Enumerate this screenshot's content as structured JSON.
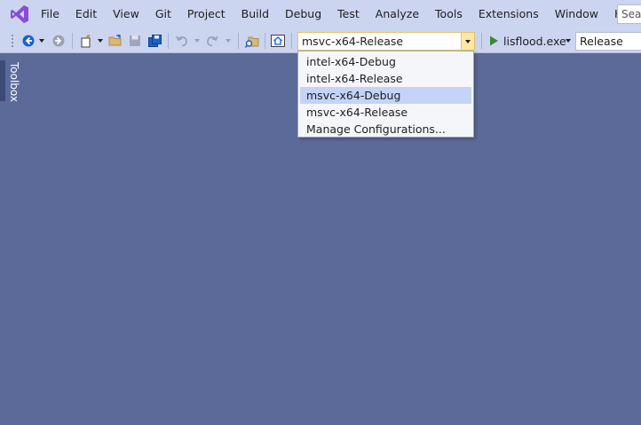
{
  "menu": {
    "items": [
      "File",
      "Edit",
      "View",
      "Git",
      "Project",
      "Build",
      "Debug",
      "Test",
      "Analyze",
      "Tools",
      "Extensions",
      "Window",
      "Help"
    ],
    "search_placeholder": "Sear"
  },
  "toolbar": {
    "solution_configuration": "msvc-x64-Release",
    "startup_item": "lisflood.exe",
    "platform_value": "Release"
  },
  "toolbox": {
    "label": "Toolbox"
  },
  "config_dropdown": {
    "items": [
      "intel-x64-Debug",
      "intel-x64-Release",
      "msvc-x64-Debug",
      "msvc-x64-Release",
      "Manage Configurations..."
    ],
    "highlighted_index": 2
  },
  "colors": {
    "chrome": "#ccd5f0",
    "workspace": "#5c6a99",
    "accent_logo": "#8a4bd6",
    "run_green": "#3a8a2e",
    "dropdown_highlight": "#c4d3f7",
    "combo_border": "#e5c365"
  },
  "icons": [
    "visual-studio-logo-icon",
    "back-icon",
    "forward-icon",
    "new-project-icon",
    "open-folder-icon",
    "save-icon",
    "save-all-icon",
    "undo-icon",
    "redo-icon",
    "find-in-files-icon",
    "home-icon",
    "run-icon"
  ]
}
